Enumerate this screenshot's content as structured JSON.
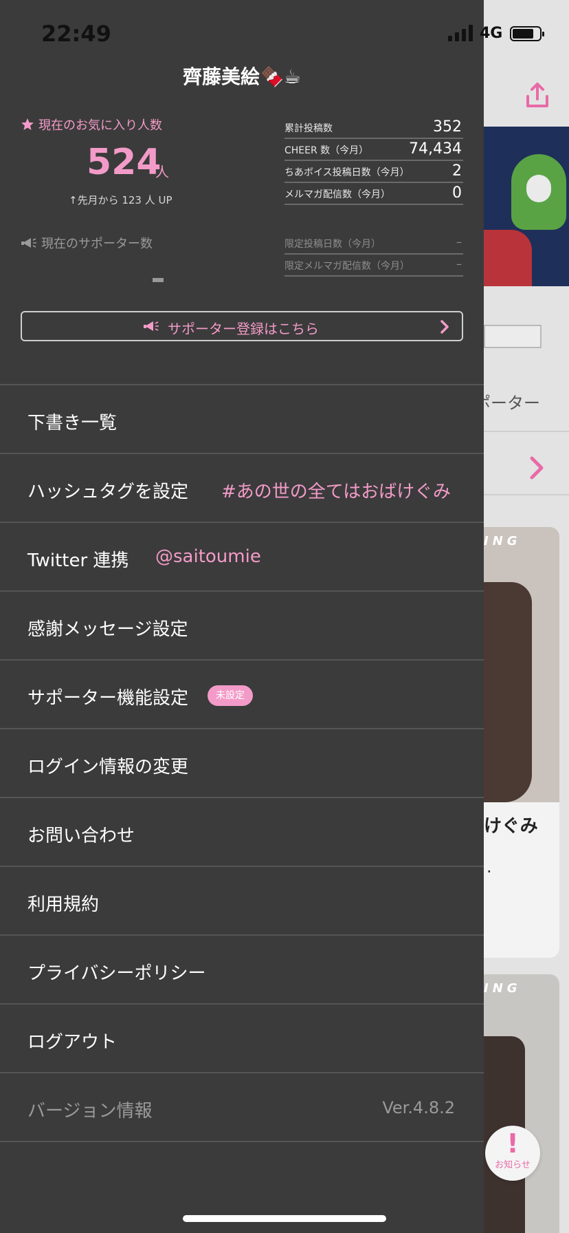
{
  "status_bar": {
    "time": "22:49",
    "network": "4G"
  },
  "profile": {
    "name": "齊藤美絵🍫☕"
  },
  "favorites": {
    "label": "現在のお気に入り人数",
    "count": "524",
    "unit": "人",
    "delta": "↑先月から 123 人 UP"
  },
  "supporters": {
    "label": "現在のサポーター数"
  },
  "stats": [
    {
      "label": "累計投稿数",
      "value": "352"
    },
    {
      "label": "CHEER 数（今月）",
      "value": "74,434"
    },
    {
      "label": "ちあボイス投稿日数（今月）",
      "value": "2"
    },
    {
      "label": "メルマガ配信数（今月）",
      "value": "0"
    }
  ],
  "limited_stats": [
    {
      "label": "限定投稿日数（今月）",
      "value": "–"
    },
    {
      "label": "限定メルマガ配信数（今月）",
      "value": "–"
    }
  ],
  "register_button": {
    "label": "サポーター登録はこちら"
  },
  "menu": [
    {
      "label": "下書き一覧"
    },
    {
      "label": "ハッシュタグを設定",
      "sub": "#あの世の全てはおばけぐみ"
    },
    {
      "label": "Twitter 連携",
      "sub": "@saitoumie"
    },
    {
      "label": "感謝メッセージ設定"
    },
    {
      "label": "サポーター機能設定",
      "badge": "未設定"
    },
    {
      "label": "ログイン情報の変更"
    },
    {
      "label": "お問い合わせ"
    },
    {
      "label": "利用規約"
    },
    {
      "label": "プライバシーポリシー"
    },
    {
      "label": "ログアウト"
    },
    {
      "label": "バージョン情報",
      "version": "Ver.4.8.2"
    }
  ],
  "background": {
    "supporter_text": "ポーター",
    "card1_tag": "ING",
    "card1_title": "けぐみ",
    "card1_dot": ".",
    "card2_tag": "ING",
    "notice_label": "お知らせ"
  },
  "colors": {
    "accent": "#f39bc8",
    "drawer_bg": "#3b3b3b"
  }
}
